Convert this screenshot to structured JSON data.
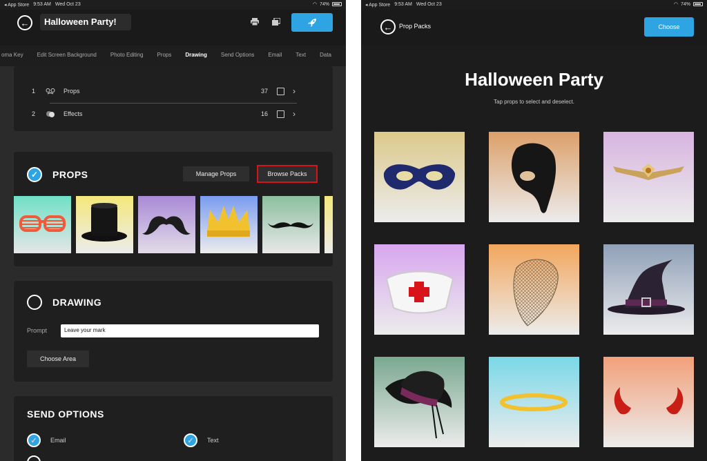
{
  "left": {
    "status": {
      "carrier": "◂ App Store",
      "time": "9:53 AM",
      "date": "Wed Oct 23",
      "battery": "74%"
    },
    "header": {
      "title": "Halloween Party!"
    },
    "tabs": [
      {
        "label": "oma Key"
      },
      {
        "label": "Edit Screen Background"
      },
      {
        "label": "Photo Editing"
      },
      {
        "label": "Props"
      },
      {
        "label": "Drawing"
      },
      {
        "label": "Send Options"
      },
      {
        "label": "Email"
      },
      {
        "label": "Text"
      },
      {
        "label": "Data"
      }
    ],
    "list": [
      {
        "num": "1",
        "label": "Props",
        "count": "37"
      },
      {
        "num": "2",
        "label": "Effects",
        "count": "16"
      }
    ],
    "props": {
      "title": "PROPS",
      "manage": "Manage Props",
      "browse": "Browse Packs"
    },
    "drawing": {
      "title": "DRAWING",
      "prompt_label": "Prompt",
      "prompt_value": "Leave your mark",
      "choose_area": "Choose Area"
    },
    "send": {
      "title": "SEND OPTIONS",
      "email": "Email",
      "text": "Text"
    }
  },
  "right": {
    "status": {
      "carrier": "◂ App Store",
      "time": "9:53 AM",
      "date": "Wed Oct 23",
      "battery": "74%"
    },
    "header": {
      "back_label": "Prop Packs",
      "choose": "Choose"
    },
    "title": "Halloween Party",
    "subtitle": "Tap props to select and deselect."
  },
  "colors": {
    "accent": "#2fa4e2",
    "highlight": "#d8131a"
  }
}
